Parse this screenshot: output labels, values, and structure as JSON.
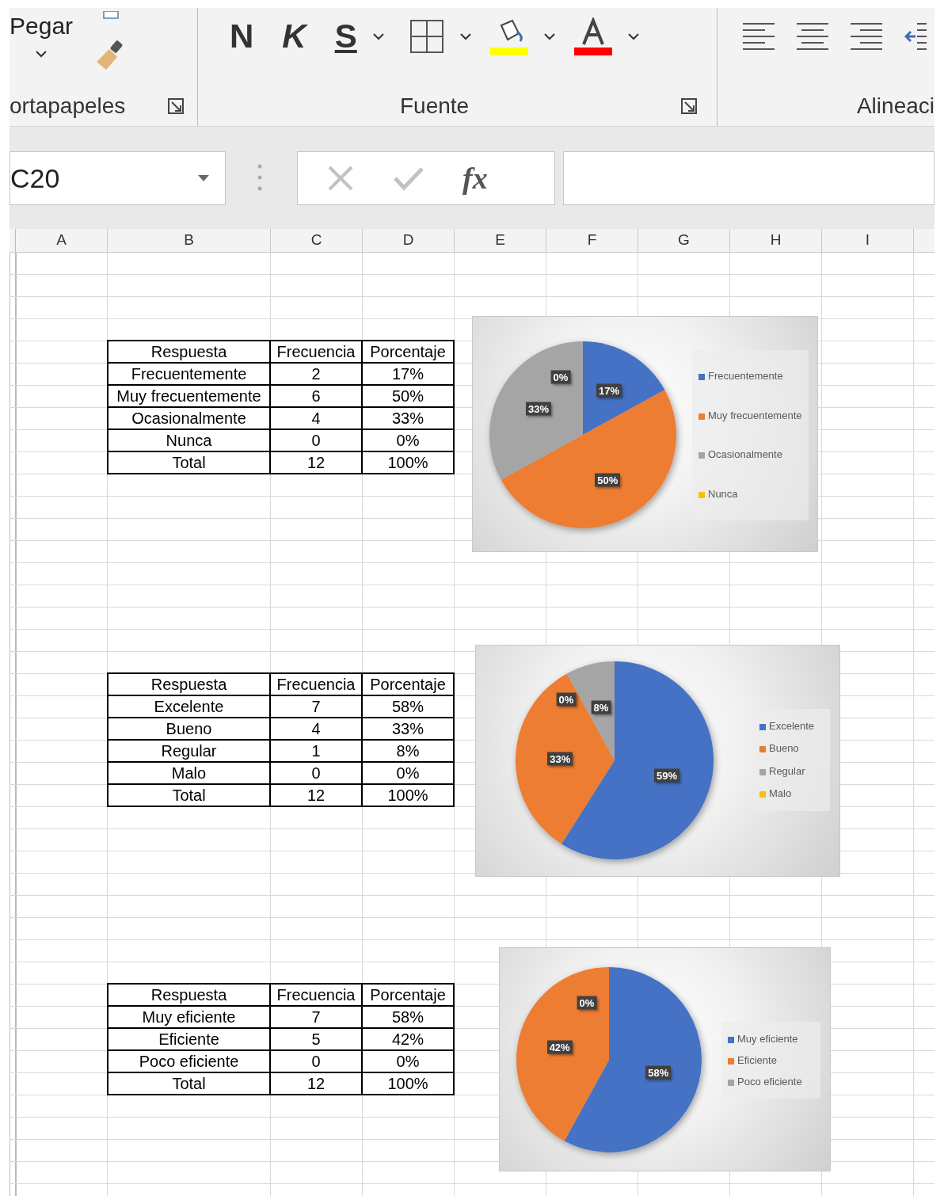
{
  "ribbon": {
    "paste_label": "Pegar",
    "font_buttons": [
      "N",
      "K",
      "S"
    ],
    "groups": [
      {
        "label": "ortapapeles"
      },
      {
        "label": "Fuente"
      },
      {
        "label": "Alineaci"
      }
    ]
  },
  "formula_bar": {
    "name_box": "C20",
    "function_label": "fx"
  },
  "columns": [
    "A",
    "B",
    "C",
    "D",
    "E",
    "F",
    "G",
    "H",
    "I"
  ],
  "tables": [
    {
      "headers": [
        "Respuesta",
        "Frecuencia",
        "Porcentaje"
      ],
      "rows": [
        [
          "Frecuentemente",
          "2",
          "17%"
        ],
        [
          "Muy frecuentemente",
          "6",
          "50%"
        ],
        [
          "Ocasionalmente",
          "4",
          "33%"
        ],
        [
          "Nunca",
          "0",
          "0%"
        ],
        [
          "Total",
          "12",
          "100%"
        ]
      ]
    },
    {
      "headers": [
        "Respuesta",
        "Frecuencia",
        "Porcentaje"
      ],
      "rows": [
        [
          "Excelente",
          "7",
          "58%"
        ],
        [
          "Bueno",
          "4",
          "33%"
        ],
        [
          "Regular",
          "1",
          "8%"
        ],
        [
          "Malo",
          "0",
          "0%"
        ],
        [
          "Total",
          "12",
          "100%"
        ]
      ]
    },
    {
      "headers": [
        "Respuesta",
        "Frecuencia",
        "Porcentaje"
      ],
      "rows": [
        [
          "Muy eficiente",
          "7",
          "58%"
        ],
        [
          "Eficiente",
          "5",
          "42%"
        ],
        [
          "Poco eficiente",
          "0",
          "0%"
        ],
        [
          "Total",
          "12",
          "100%"
        ]
      ]
    }
  ],
  "charts": [
    {
      "slices": [
        {
          "color": "#4472c4"
        },
        {
          "color": "#ed7d31"
        },
        {
          "color": "#a5a5a5"
        },
        {
          "color": "#ffc000"
        }
      ],
      "chart_data": {
        "type": "pie",
        "categories": [
          "Frecuentemente",
          "Muy frecuentemente",
          "Ocasionalmente",
          "Nunca"
        ],
        "values": [
          17,
          50,
          33,
          0
        ],
        "value_labels": [
          "17%",
          "50%",
          "33%",
          "0%"
        ],
        "legend": "right"
      }
    },
    {
      "slices": [
        {
          "color": "#4472c4"
        },
        {
          "color": "#ed7d31"
        },
        {
          "color": "#a5a5a5"
        },
        {
          "color": "#ffc000"
        }
      ],
      "chart_data": {
        "type": "pie",
        "categories": [
          "Excelente",
          "Bueno",
          "Regular",
          "Malo"
        ],
        "values": [
          59,
          33,
          8,
          0
        ],
        "value_labels": [
          "59%",
          "33%",
          "8%",
          "0%"
        ],
        "legend": "right"
      }
    },
    {
      "slices": [
        {
          "color": "#4472c4"
        },
        {
          "color": "#ed7d31"
        },
        {
          "color": "#a5a5a5"
        }
      ],
      "chart_data": {
        "type": "pie",
        "categories": [
          "Muy eficiente",
          "Eficiente",
          "Poco eficiente"
        ],
        "values": [
          58,
          42,
          0
        ],
        "value_labels": [
          "58%",
          "42%",
          "0%"
        ],
        "legend": "right"
      }
    }
  ]
}
